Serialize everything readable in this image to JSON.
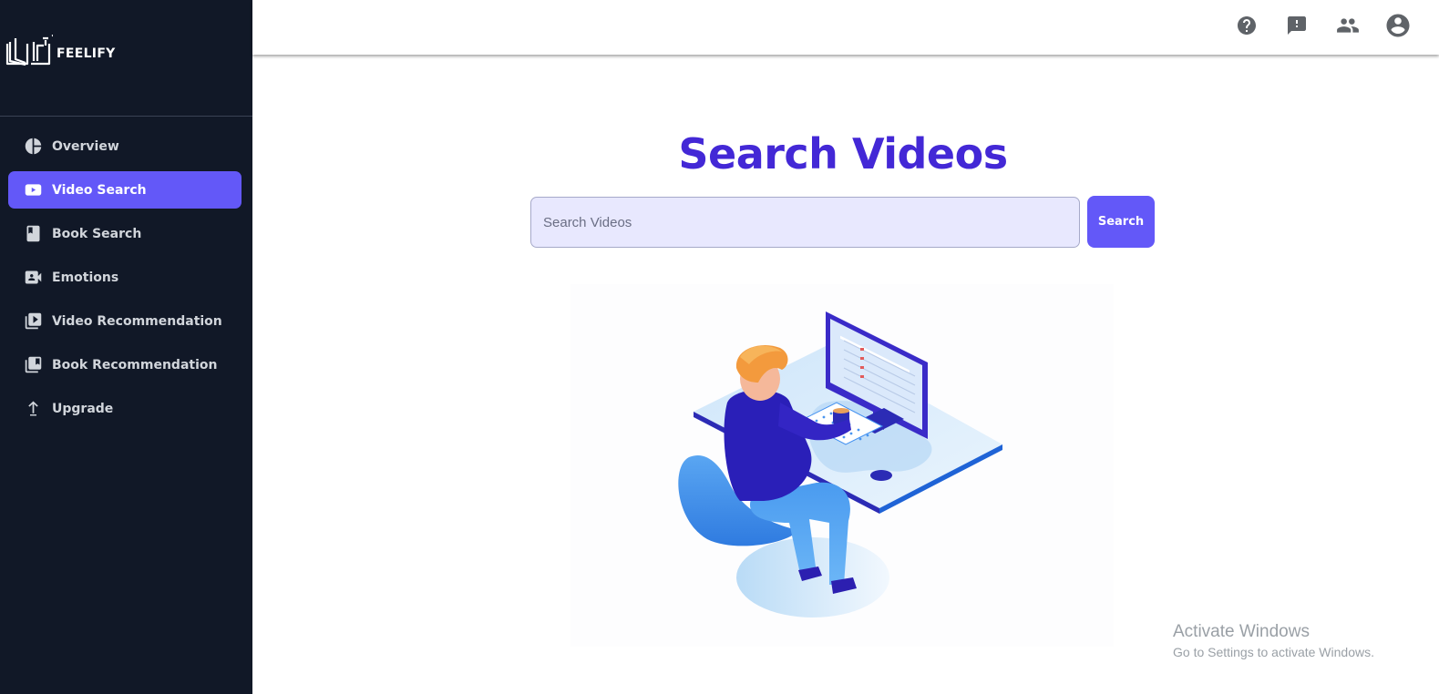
{
  "brand": {
    "name": "FEELIFY"
  },
  "sidebar": {
    "items": [
      {
        "label": "Overview",
        "icon": "pie-chart-icon",
        "active": false
      },
      {
        "label": "Video Search",
        "icon": "youtube-play-icon",
        "active": true
      },
      {
        "label": "Book Search",
        "icon": "book-icon",
        "active": false
      },
      {
        "label": "Emotions",
        "icon": "video-camera-icon",
        "active": false
      },
      {
        "label": "Video Recommendation",
        "icon": "video-library-icon",
        "active": false
      },
      {
        "label": "Book Recommendation",
        "icon": "book-library-icon",
        "active": false
      },
      {
        "label": "Upgrade",
        "icon": "upload-arrow-icon",
        "active": false
      }
    ]
  },
  "topbar": {
    "icons": [
      "help-icon",
      "feedback-icon",
      "people-icon",
      "account-icon"
    ]
  },
  "main": {
    "title": "Search Videos",
    "search": {
      "placeholder": "Search Videos",
      "value": ""
    },
    "search_button": "Search"
  },
  "watermark": {
    "title": "Activate Windows",
    "subtitle": "Go to Settings to activate Windows."
  },
  "colors": {
    "sidebar_bg": "#111827",
    "accent": "#6358f8",
    "title": "#4328d6",
    "input_bg": "#e8e8fe"
  }
}
